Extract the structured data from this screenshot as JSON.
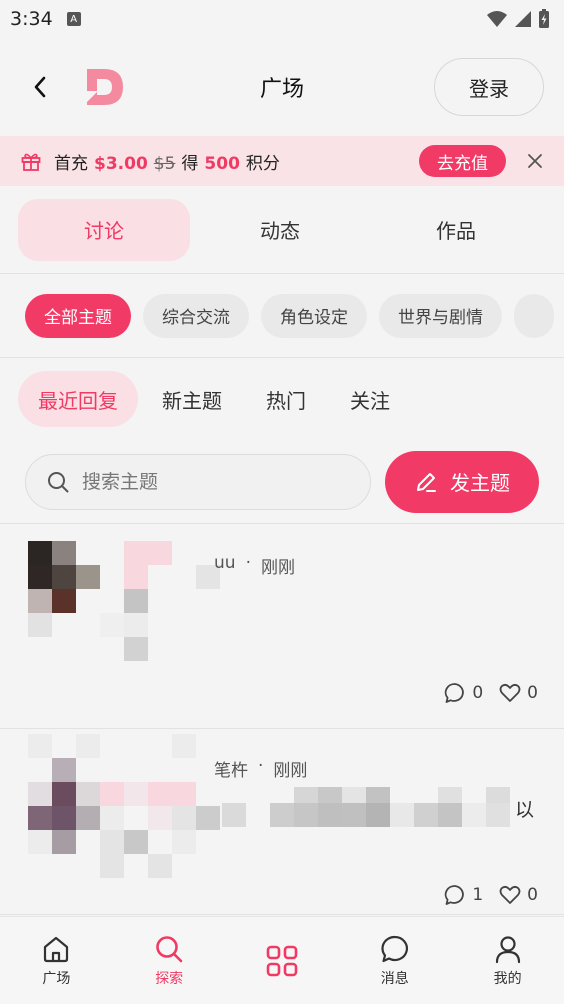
{
  "status_bar": {
    "time": "3:34",
    "notif_glyph": "A"
  },
  "header": {
    "title": "广场",
    "login_label": "登录"
  },
  "promo": {
    "prefix": "首充",
    "price": "$3.00",
    "original_price": "$5",
    "get_label": "得",
    "points": "500",
    "points_unit": "积分",
    "recharge_label": "去充值"
  },
  "main_tabs": [
    "讨论",
    "动态",
    "作品"
  ],
  "chips": [
    "全部主题",
    "综合交流",
    "角色设定",
    "世界与剧情"
  ],
  "sort_tabs": [
    "最近回复",
    "新主题",
    "热门",
    "关注"
  ],
  "search": {
    "placeholder": "搜索主题",
    "post_label": "发主题"
  },
  "posts": [
    {
      "author": "uu",
      "separator": "·",
      "time": "刚刚",
      "comments": "0",
      "likes": "0",
      "tail": ""
    },
    {
      "author": "笔杵",
      "separator": "·",
      "time": "刚刚",
      "comments": "1",
      "likes": "0",
      "tail": "以"
    }
  ],
  "bottom_nav": [
    {
      "label": "广场",
      "icon": "home-icon"
    },
    {
      "label": "探索",
      "icon": "search-icon"
    },
    {
      "label": "",
      "icon": "grid-icon"
    },
    {
      "label": "消息",
      "icon": "message-icon"
    },
    {
      "label": "我的",
      "icon": "profile-icon"
    }
  ],
  "colors": {
    "accent": "#f23a66",
    "accent_soft": "#fadfe5",
    "background": "#f4f4f4"
  }
}
